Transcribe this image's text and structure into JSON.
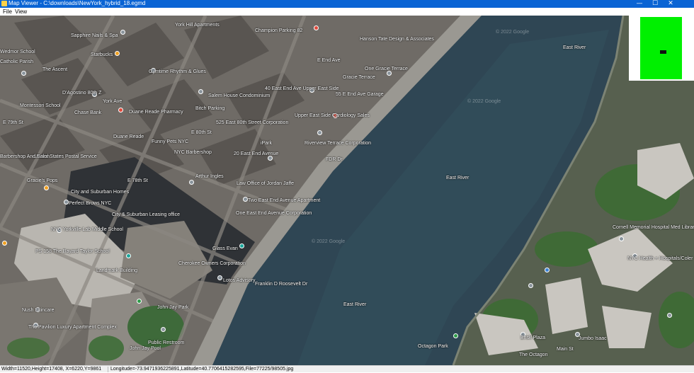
{
  "window": {
    "title": "Map Viewer - C:\\downloads\\NewYork_hybrid_18.egmd",
    "minimize": "—",
    "maximize": "☐",
    "close": "✕"
  },
  "menu": {
    "file": "File",
    "view": "View"
  },
  "map": {
    "labels": [
      "Sapphire Nails & Spa",
      "Starbucks",
      "Wedmor School",
      "Catholic Parish",
      "The Ascent",
      "D'Agostino 80th Z",
      "Montessori School",
      "Chase Bank",
      "Duane Reade Pharmacy",
      "Duane Reade",
      "E 79th St",
      "Funny Pets NYC",
      "NYC Barbershop",
      "E 80th St",
      "United States Postal Service",
      "Barbershop And Salon",
      "Gracie's Pops",
      "City and Suburban Homes",
      "Perfect Brows NYC",
      "City & Suburban Leasing office",
      "E 78th St",
      "NYC Yorkville Lab Middle School",
      "PS 158 The Bayard Taylor School",
      "Landmark Building",
      "Glass Evan",
      "Cherokee Owners Corporation",
      "Lotos Advisory",
      "Nush Skincare",
      "The Pavilion Luxury Apartment Complex",
      "Public Restroom",
      "John Jay Park",
      "John Jay Pool",
      "York Hill Apartments",
      "Champion Parking 82",
      "Hanson Tate Design & Associates",
      "Gymtime Rhythm & Glues",
      "Salem House Condominium",
      "40 East End Ave Upper East Side",
      "55 E End Ave Garage",
      "One Gracie Terrace",
      "Gracie Terrace",
      "Bitch Parking",
      "Upper East Side Cardiology Sales",
      "525 East 80th Street Corporation",
      "iPark",
      "20 East End Avenue",
      "Riverview Terrace Corporation",
      "Law Office of Jordan Jaffe",
      "Two East End Avenue Apartment",
      "One East End Avenue Corporation",
      "Arthur Ingles",
      "FDR Dr",
      "East River",
      "Cornell Memorial Hospital Med Library",
      "NYC Health + Hospitals/Coler",
      "Octagon Park",
      "Brisk Plaza",
      "Jumbo Isaac",
      "The Octagon",
      "Main St",
      "Franklin D Roosevelt Dr",
      "York Ave",
      "E End Ave",
      "© 2022 Google"
    ]
  },
  "minimap": {
    "background": "#00f000",
    "marker": "#111111"
  },
  "status": {
    "dims": "Width=11520,Height=17408, X=6220,Y=9861",
    "coords": "Longitude=-73.9471936225891,Latitude=40.7706415282595,File=77225/98505.jpg"
  }
}
